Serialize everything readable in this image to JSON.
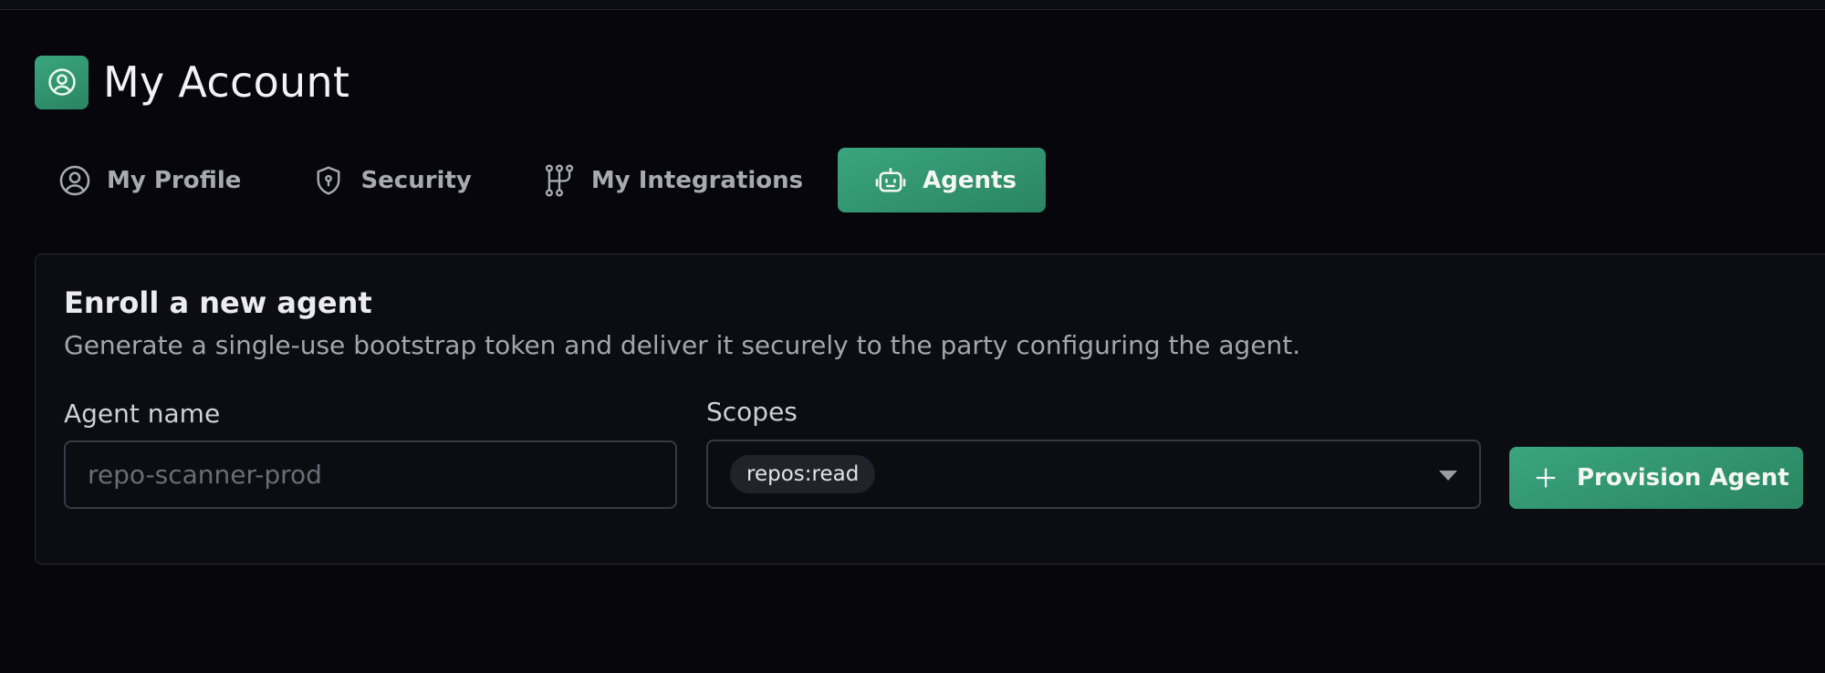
{
  "header": {
    "title": "My Account",
    "icon": "user-circle-icon"
  },
  "tabs": [
    {
      "label": "My Profile",
      "icon": "user-circle-icon",
      "active": false
    },
    {
      "label": "Security",
      "icon": "shield-icon",
      "active": false
    },
    {
      "label": "My Integrations",
      "icon": "integrations-icon",
      "active": false
    },
    {
      "label": "Agents",
      "icon": "robot-icon",
      "active": true
    }
  ],
  "enroll": {
    "title": "Enroll a new agent",
    "description": "Generate a single-use bootstrap token and deliver it securely to the party configuring the agent.",
    "agent_name_label": "Agent name",
    "agent_name_placeholder": "repo-scanner-prod",
    "agent_name_value": "",
    "scopes_label": "Scopes",
    "scopes_selected": [
      "repos:read"
    ],
    "provision_label": "Provision Agent"
  },
  "colors": {
    "accent": "#34a07a",
    "background": "#06060c",
    "card": "#0c0c13",
    "border": "#2a2a34"
  }
}
